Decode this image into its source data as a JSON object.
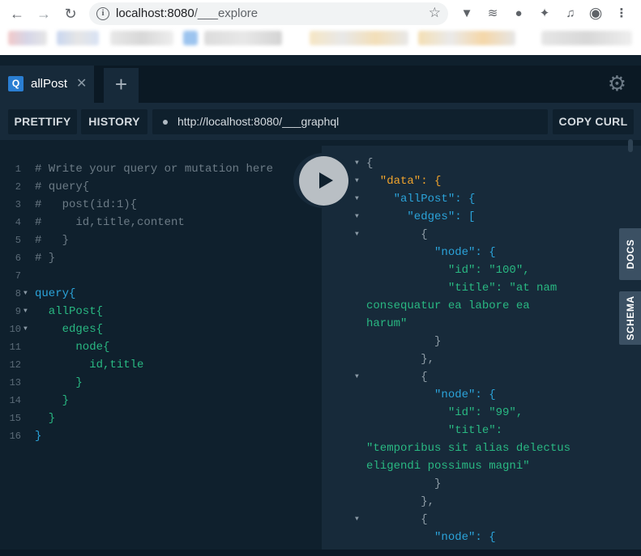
{
  "browser": {
    "url_host": "localhost:8080",
    "url_path": "/___explore"
  },
  "tab": {
    "badge": "Q",
    "name": "allPost"
  },
  "toolbar": {
    "prettify_label": "PRETTIFY",
    "history_label": "HISTORY",
    "endpoint_url": "http://localhost:8080/___graphql",
    "copy_curl_label": "COPY CURL"
  },
  "editor": {
    "lines": [
      "# Write your query or mutation here",
      "# query{",
      "#   post(id:1){",
      "#     id,title,content",
      "#   }",
      "# }",
      "",
      "query{",
      "  allPost{",
      "    edges{",
      "      node{",
      "        id,title",
      "      }",
      "    }",
      "  }",
      "}"
    ]
  },
  "result": {
    "lines": [
      "{",
      "  \"data\": {",
      "    \"allPost\": {",
      "      \"edges\": [",
      "        {",
      "          \"node\": {",
      "            \"id\": \"100\",",
      "            \"title\": \"at nam",
      "consequatur ea labore ea",
      "harum\"",
      "          }",
      "        },",
      "        {",
      "          \"node\": {",
      "            \"id\": \"99\",",
      "            \"title\":",
      "\"temporibus sit alias delectus",
      "eligendi possimus magni\"",
      "          }",
      "        },",
      "        {",
      "          \"node\": {"
    ]
  },
  "sidebar": {
    "docs_label": "DOCS",
    "schema_label": "SCHEMA"
  }
}
